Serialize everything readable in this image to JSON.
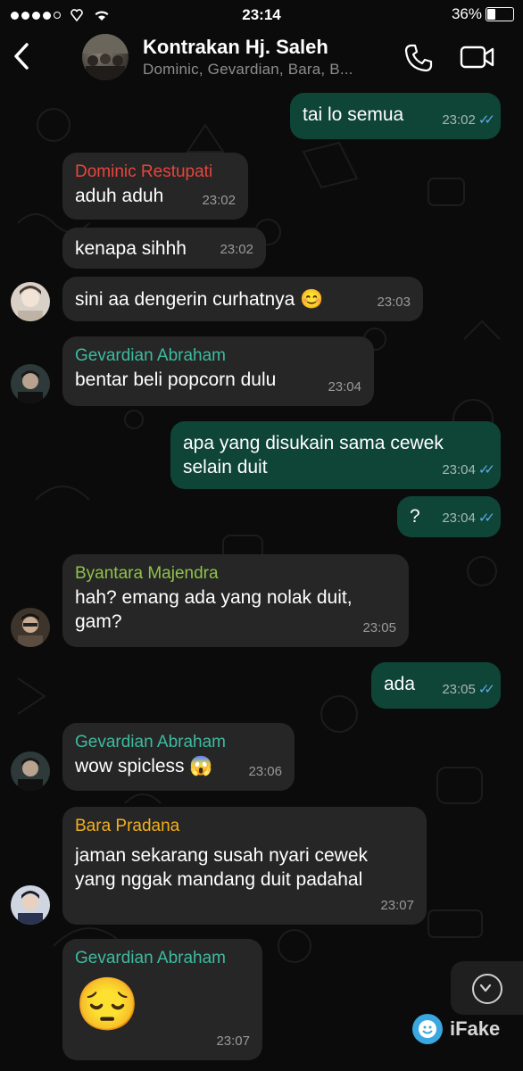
{
  "status_bar": {
    "time": "23:14",
    "battery": "36%",
    "battery_level": 0.36
  },
  "header": {
    "title": "Kontrakan Hj. Saleh",
    "subtitle": "Dominic, Gevardian, Bara, B...",
    "icons": [
      "back-chevron-icon",
      "group-avatar",
      "phone-icon",
      "video-icon"
    ]
  },
  "colors": {
    "incoming_bubble": "#262626",
    "outgoing_bubble": "#0f4537",
    "read_ticks": "#5fa8e8",
    "sender_dominic": "#e8453c",
    "sender_gevardian": "#3dbba0",
    "sender_byantara": "#8fc24a",
    "sender_bara": "#f2b01e"
  },
  "messages": [
    {
      "dir": "out",
      "text": "tai lo semua",
      "time": "23:02"
    },
    {
      "dir": "in",
      "sender": "Dominic Restupati",
      "text": "aduh aduh",
      "time": "23:02"
    },
    {
      "dir": "in",
      "text": "kenapa sihhh",
      "time": "23:02"
    },
    {
      "dir": "in",
      "text": "sini aa dengerin curhatnya 😊",
      "time": "23:03"
    },
    {
      "dir": "in",
      "sender": "Gevardian Abraham",
      "text": "bentar beli popcorn dulu",
      "time": "23:04"
    },
    {
      "dir": "out",
      "line1": "apa yang disukain sama cewek",
      "line2": "selain duit",
      "time": "23:04"
    },
    {
      "dir": "out",
      "text": "?",
      "time": "23:04"
    },
    {
      "dir": "in",
      "sender": "Byantara Majendra",
      "line1": "hah? emang ada yang nolak duit,",
      "line2": "gam?",
      "time": "23:05"
    },
    {
      "dir": "out",
      "text": "ada",
      "time": "23:05"
    },
    {
      "dir": "in",
      "sender": "Gevardian Abraham",
      "text": "wow spicless 😱",
      "time": "23:06"
    },
    {
      "dir": "in",
      "sender": "Bara Pradana",
      "line1": "jaman sekarang susah nyari cewek",
      "line2": "yang nggak mandang duit padahal",
      "time": "23:07"
    },
    {
      "dir": "in",
      "sender": "Gevardian Abraham",
      "text": "😔",
      "time": "23:07"
    }
  ],
  "watermark": {
    "label": "iFake"
  }
}
